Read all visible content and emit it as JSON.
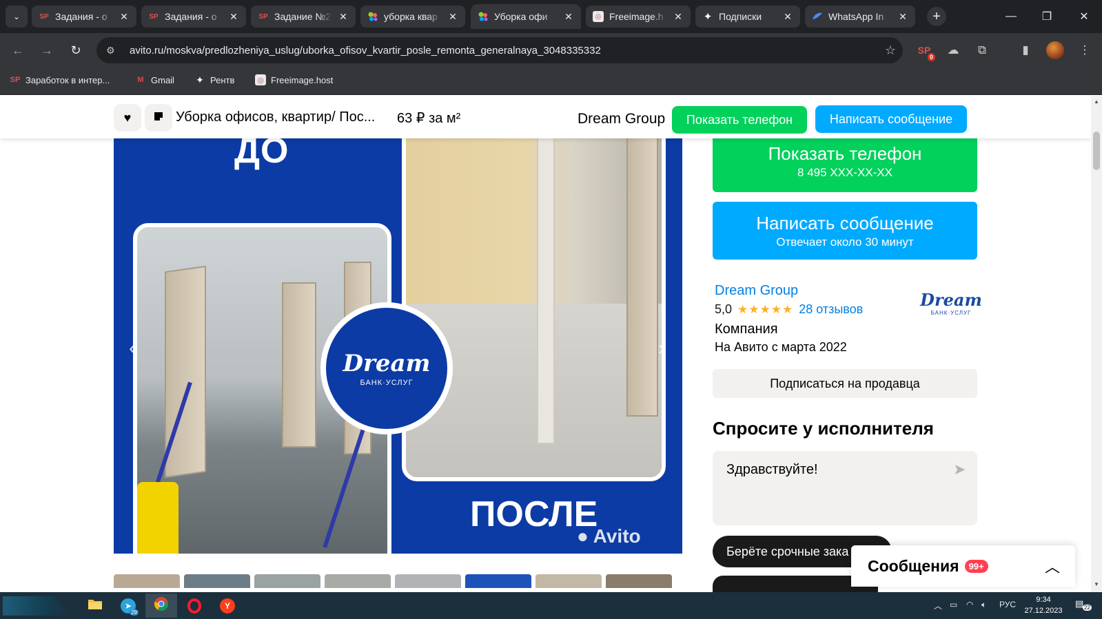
{
  "browser": {
    "tabs": [
      {
        "title": "Задания - o",
        "favicon": "SP",
        "color": "#d9534f"
      },
      {
        "title": "Задания - o",
        "favicon": "SP",
        "color": "#d9534f"
      },
      {
        "title": "Задание №2",
        "favicon": "SP",
        "color": "#d9534f"
      },
      {
        "title": "уборка квар",
        "favicon": "avito-icon",
        "color": "#97cf26"
      },
      {
        "title": "Уборка офи",
        "favicon": "avito-icon",
        "color": "#97cf26"
      },
      {
        "title": "Freeimage.h",
        "favicon": "freeimage-icon",
        "color": "#e8eaed"
      },
      {
        "title": "Подписки",
        "favicon": "star4-icon",
        "color": "#ffffff"
      },
      {
        "title": "WhatsApp In",
        "favicon": "whatsapp-icon",
        "color": "#1a73e8"
      }
    ],
    "url": "avito.ru/moskva/predlozheniya_uslug/uborka_ofisov_kvartir_posle_remonta_generalnaya_3048335332",
    "extension_badge": "0",
    "bookmarks": [
      {
        "label": "Заработок в интер...",
        "favicon": "SP"
      },
      {
        "label": "Gmail",
        "favicon": "M"
      },
      {
        "label": "Рентв",
        "favicon": "star4-icon"
      },
      {
        "label": "Freeimage.host",
        "favicon": "freeimage-icon"
      }
    ]
  },
  "page": {
    "sticky": {
      "title": "Уборка офисов, квартир/ Пос...",
      "price": "63 ₽ за м²",
      "seller": "Dream Group",
      "show_phone": "Показать телефон",
      "write_message": "Написать сообщение"
    },
    "photo": {
      "before_label": "ДО",
      "after_label": "ПОСЛЕ",
      "logo_text": "Dream",
      "logo_subtitle": "БАНК·УСЛУГ",
      "watermark": "Avito"
    },
    "contact": {
      "phone_title": "Показать телефон",
      "phone_number": "8 495 XXX-XX-XX",
      "message_title": "Написать сообщение",
      "message_subtitle": "Отвечает около 30 минут"
    },
    "seller": {
      "name": "Dream Group",
      "rating": "5,0",
      "stars": "★★★★★",
      "reviews": "28 отзывов",
      "type": "Компания",
      "since": "На Авито с марта 2022",
      "logo_text": "Dream",
      "logo_subtitle": "БАНК·УСЛУГ",
      "subscribe": "Подписаться на продавца"
    },
    "ask": {
      "title": "Спросите у исполнителя",
      "message": "Здравствуйте!",
      "chip": "Берёте срочные зака"
    },
    "messages": {
      "title": "Сообщения",
      "badge": "99+"
    }
  },
  "taskbar": {
    "telegram_count": "29",
    "language": "РУС",
    "time": "9:34",
    "date": "27.12.2023",
    "notifications": "22"
  },
  "colors": {
    "avito_green": "#02d15c",
    "avito_blue": "#00aaff",
    "link_blue": "#0080e6",
    "photo_blue": "#0c3ba5",
    "badge_red": "#ff4053"
  }
}
